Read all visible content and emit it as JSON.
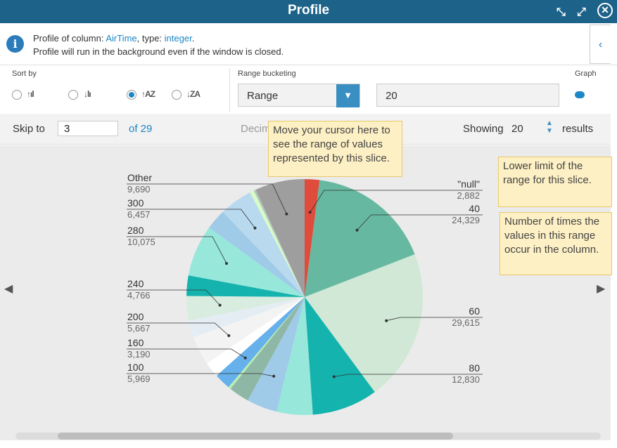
{
  "window": {
    "title": "Profile"
  },
  "info": {
    "line1_prefix": "Profile of column: ",
    "column": "AirTime",
    "line1_mid": ", type: ",
    "type": "integer",
    "line1_end": ".",
    "line2": "Profile will run in the background even if the window is closed."
  },
  "sort": {
    "label": "Sort by",
    "options": [
      "count-asc-icon",
      "count-desc-icon",
      "alpha-asc-icon",
      "alpha-desc-icon"
    ],
    "option_glyphs": [
      "↑ıl",
      "↓lı",
      "↑AZ",
      "↓ZA"
    ],
    "selected_index": 2
  },
  "range": {
    "label": "Range bucketing",
    "select_value": "Range",
    "bucket_value": "20"
  },
  "graph": {
    "label": "Graph",
    "toggle_on": true
  },
  "skip": {
    "label": "Skip to",
    "value": "3",
    "of_label": "of 29"
  },
  "decimal": {
    "label": "Decimal Places"
  },
  "showing": {
    "label": "Showing",
    "value": "20",
    "suffix": "results"
  },
  "callouts": {
    "cursor": "Move your cursor here to see the range of values represented by this slice.",
    "lower": "Lower limit of the range for this slice.",
    "count": "Number of times the values in this range occur in the column."
  },
  "chart_data": {
    "type": "pie",
    "slices": [
      {
        "label": "\"null\"",
        "value": 2882,
        "color": "#e04c3c"
      },
      {
        "label": "40",
        "value": 24329,
        "color": "#66b9a0"
      },
      {
        "label": "60",
        "value": 29615,
        "color": "#d0e8d5"
      },
      {
        "label": "80",
        "value": 12830,
        "color": "#15b3ae"
      },
      {
        "label": "",
        "value": 7000,
        "color": "#97e7db"
      },
      {
        "label": "100",
        "value": 5969,
        "color": "#9fcbe8"
      },
      {
        "label": "",
        "value": 4000,
        "color": "#8fb7a6"
      },
      {
        "label": "",
        "value": 500,
        "color": "#b6f0b0"
      },
      {
        "label": "160",
        "value": 3190,
        "color": "#66b0eb"
      },
      {
        "label": "",
        "value": 3000,
        "color": "#ffffff"
      },
      {
        "label": "200",
        "value": 5667,
        "color": "#f3f3f3"
      },
      {
        "label": "",
        "value": 3300,
        "color": "#e4edf3"
      },
      {
        "label": "240",
        "value": 4766,
        "color": "#d8ece0"
      },
      {
        "label": "",
        "value": 4000,
        "color": "#15b3ae"
      },
      {
        "label": "280",
        "value": 10075,
        "color": "#97e7db"
      },
      {
        "label": "",
        "value": 4000,
        "color": "#9fcbe8"
      },
      {
        "label": "300",
        "value": 6457,
        "color": "#b9d9ef"
      },
      {
        "label": "",
        "value": 800,
        "color": "#d9fcc7"
      },
      {
        "label": "",
        "value": 400,
        "color": "#b3c7bc"
      },
      {
        "label": "Other",
        "value": 9690,
        "color": "#9e9e9e"
      }
    ],
    "right_labels": [
      {
        "label": "\"null\"",
        "count": "2,882"
      },
      {
        "label": "40",
        "count": "24,329"
      },
      {
        "label": "60",
        "count": "29,615"
      },
      {
        "label": "80",
        "count": "12,830"
      }
    ],
    "left_labels": [
      {
        "label": "Other",
        "count": "9,690"
      },
      {
        "label": "300",
        "count": "6,457"
      },
      {
        "label": "280",
        "count": "10,075"
      },
      {
        "label": "240",
        "count": "4,766"
      },
      {
        "label": "200",
        "count": "5,667"
      },
      {
        "label": "160",
        "count": "3,190"
      },
      {
        "label": "100",
        "count": "5,969"
      }
    ]
  }
}
